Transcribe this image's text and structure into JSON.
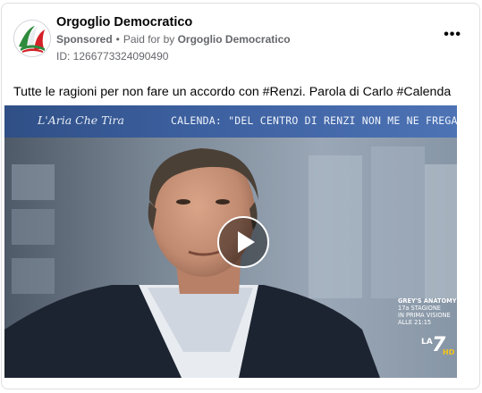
{
  "post": {
    "page_name": "Orgoglio Democratico",
    "sponsored_label": "Sponsored",
    "separator": "•",
    "paid_for_label": "Paid for by",
    "payer_name": "Orgoglio Democratico",
    "ad_id": "ID: 1266773324090490",
    "more_icon": "more-options-icon",
    "more_glyph": "•••",
    "caption": "Tutte le ragioni per non fare un accordo con #Renzi. Parola di Carlo #Calenda"
  },
  "video": {
    "show_logo": "L'Aria Che Tira",
    "headline": "CALENDA: \"DEL CENTRO DI RENZI NON ME NE FREGA NULLA\"",
    "promo": {
      "line1": "GREY'S ANATOMY",
      "line2": "17a STAGIONE",
      "line3": "IN PRIMA VISIONE",
      "line4": "ALLE 21:15"
    },
    "channel": {
      "prefix": "LA",
      "number": "7",
      "badge": "HD"
    },
    "play_icon": "play-icon"
  },
  "colors": {
    "banner": "#3c5f9e",
    "text_primary": "#050505",
    "text_secondary": "#65676b",
    "card_border": "#dddfe2"
  }
}
